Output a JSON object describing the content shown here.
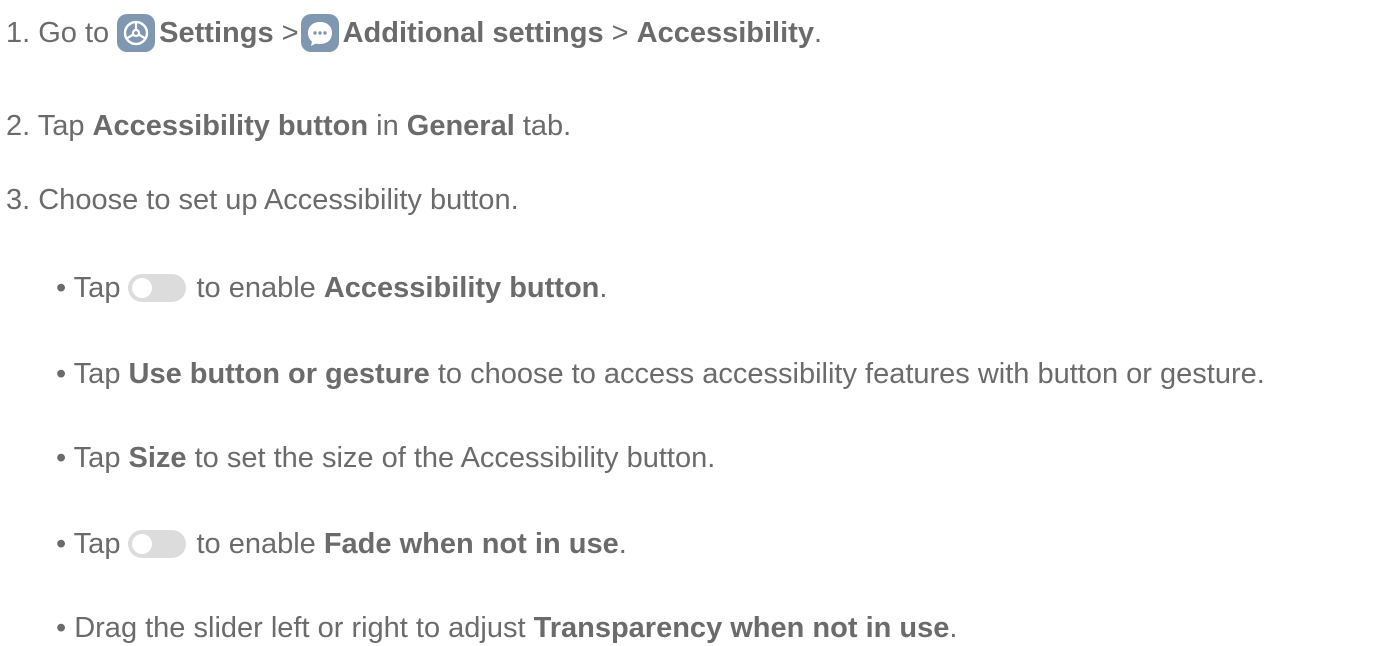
{
  "steps": {
    "step1": {
      "prefix": "1. Go to",
      "settings_icon": "gear-icon",
      "settings": "Settings",
      "sep1": " >",
      "additional_icon": "more-dots-icon",
      "additional": "Additional settings",
      "sep2": " > ",
      "accessibility": "Accessibility",
      "end": "."
    },
    "step2": {
      "prefix": "2. Tap ",
      "button": "Accessibility button",
      "mid": " in ",
      "tab": "General",
      "end": " tab."
    },
    "step3": {
      "text": "3. Choose to set up Accessibility button."
    }
  },
  "bullets": {
    "b1": {
      "prefix": "• Tap",
      "toggle_icon": "toggle-off-icon",
      "mid": "to enable ",
      "bold": "Accessibility button",
      "end": "."
    },
    "b2": {
      "prefix": "• Tap ",
      "bold": "Use button or gesture",
      "end": " to choose to access accessibility features with button or gesture."
    },
    "b3": {
      "prefix": "• Tap ",
      "bold": "Size",
      "end": " to set the size of the Accessibility button."
    },
    "b4": {
      "prefix": "• Tap",
      "toggle_icon": "toggle-off-icon",
      "mid": "to enable ",
      "bold": "Fade when not in use",
      "end": "."
    },
    "b5": {
      "prefix": "• Drag the slider left or right to adjust ",
      "bold": "Transparency when not in use",
      "end": "."
    }
  },
  "colors": {
    "text": "#6b6b6b",
    "icon_bg": "#7f97b0",
    "toggle_track": "#dcdcdc"
  }
}
